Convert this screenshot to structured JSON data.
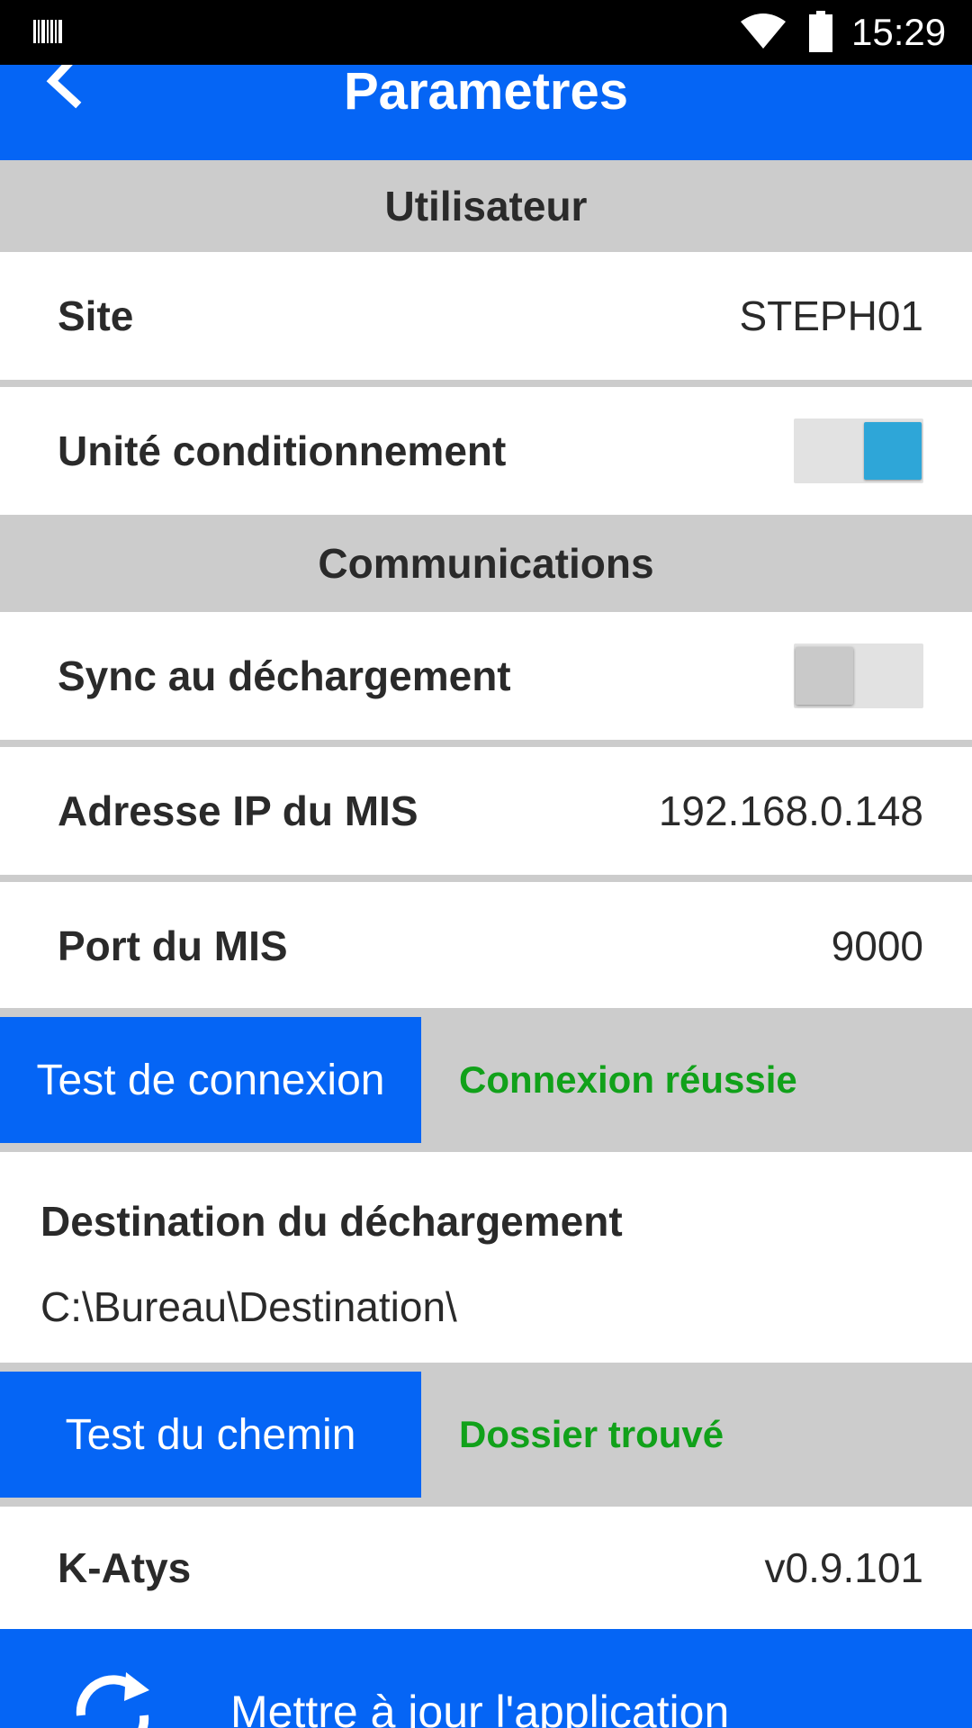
{
  "status_bar": {
    "time": "15:29",
    "icons": [
      "barcode-icon",
      "wifi-icon",
      "battery-icon"
    ]
  },
  "app_bar": {
    "title": "Parametres",
    "back_icon": "back-chevron-icon"
  },
  "sections": {
    "user": "Utilisateur",
    "communications": "Communications"
  },
  "settings": {
    "site": {
      "label": "Site",
      "value": "STEPH01"
    },
    "unit": {
      "label": "Unité conditionnement",
      "enabled": true
    },
    "sync": {
      "label": "Sync au déchargement",
      "enabled": false
    },
    "ip": {
      "label": "Adresse IP du MIS",
      "value": "192.168.0.148"
    },
    "port": {
      "label": "Port du MIS",
      "value": "9000"
    }
  },
  "connection_test": {
    "button_label": "Test de connexion",
    "status": "Connexion réussie"
  },
  "destination": {
    "title": "Destination du déchargement",
    "path": "C:\\Bureau\\Destination\\"
  },
  "path_test": {
    "button_label": "Test du chemin",
    "status": "Dossier trouvé"
  },
  "app_info": {
    "name": "K-Atys",
    "version": "v0.9.101"
  },
  "update": {
    "label": "Mettre à jour l'application"
  },
  "colors": {
    "primary": "#0565f5",
    "section_bg": "#cccccc",
    "success": "#11a11a",
    "toggle_on": "#2ea6d8"
  }
}
